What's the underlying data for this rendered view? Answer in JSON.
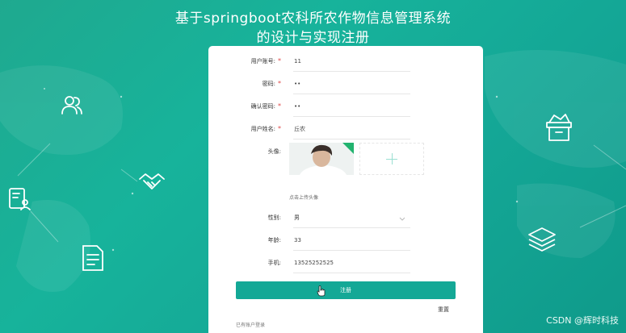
{
  "header": {
    "title_line1": "基于springboot农科所农作物信息管理系统",
    "title_line2": "的设计与实现注册"
  },
  "form": {
    "account": {
      "label": "用户账号:",
      "required": "*",
      "value": "11"
    },
    "password": {
      "label": "密码:",
      "required": "*",
      "value": "••"
    },
    "confirm_password": {
      "label": "确认密码:",
      "required": "*",
      "value": "••"
    },
    "name": {
      "label": "用户姓名:",
      "required": "*",
      "value": "丘农"
    },
    "avatar": {
      "label": "头像:",
      "upload_hint": "点击上传头像"
    },
    "gender": {
      "label": "性别:",
      "value": "男"
    },
    "age": {
      "label": "年龄:",
      "value": "33"
    },
    "phone": {
      "label": "手机:",
      "value": "13525252525"
    },
    "submit_label": "注册",
    "reset_label": "重置",
    "login_link": "已有账户登录"
  },
  "watermark": "CSDN @辉时科技",
  "colors": {
    "accent": "#14a896",
    "required": "#e04848",
    "background": "#1fa98f"
  },
  "icons": [
    "users-icon",
    "id-card-icon",
    "handshake-icon",
    "document-icon",
    "archive-box-icon",
    "layers-icon",
    "chevron-down-icon",
    "plus-icon",
    "cursor-icon"
  ]
}
